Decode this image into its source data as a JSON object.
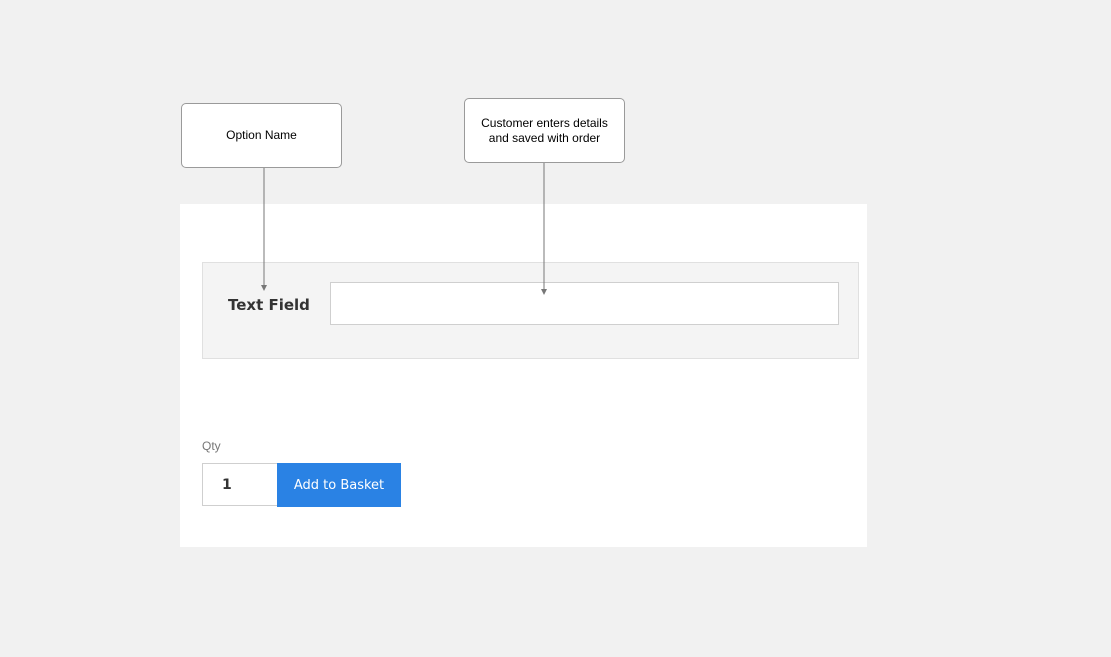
{
  "annotations": {
    "option_name": "Option Name",
    "customer_note": "Customer enters details\nand saved with order"
  },
  "product_form": {
    "option": {
      "label": "Text Field",
      "value": ""
    },
    "quantity": {
      "label": "Qty",
      "value": "1"
    },
    "add_to_basket_label": "Add to Basket"
  },
  "colors": {
    "page_background": "#f1f1f1",
    "button_background": "#2a82e4",
    "option_background": "#f4f4f4",
    "connector": "#777777"
  }
}
